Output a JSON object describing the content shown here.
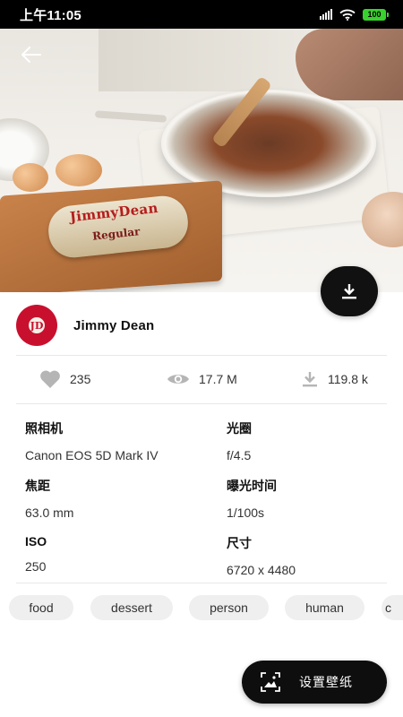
{
  "status_bar": {
    "time": "上午11:05",
    "battery": "100"
  },
  "hero": {
    "package_brand": "JimmyDean",
    "package_name": "Regular"
  },
  "author": {
    "name": "Jimmy Dean",
    "avatar_text": "JD"
  },
  "stats": {
    "likes": "235",
    "views": "17.7 M",
    "downloads": "119.8 k"
  },
  "info": {
    "camera_label": "照相机",
    "camera_value": "Canon EOS 5D Mark IV",
    "focal_label": "焦距",
    "focal_value": "63.0 mm",
    "iso_label": "ISO",
    "iso_value": "250",
    "aperture_label": "光圈",
    "aperture_value": "f/4.5",
    "exposure_label": "曝光时间",
    "exposure_value": "1/100s",
    "size_label": "尺寸",
    "size_value": "6720 x 4480"
  },
  "tags": [
    "food",
    "dessert",
    "person",
    "human",
    "c"
  ],
  "actions": {
    "set_wallpaper": "设置壁纸"
  },
  "icons": {
    "back": "arrow-left-icon",
    "download": "download-icon",
    "like": "heart-icon",
    "views": "eye-icon",
    "downloads": "download-count-icon",
    "wallpaper": "wallpaper-icon"
  },
  "colors": {
    "fab": "#111111",
    "tag_bg": "#efefef",
    "icon_gray": "#b5b5b5",
    "battery": "#39d12e"
  }
}
